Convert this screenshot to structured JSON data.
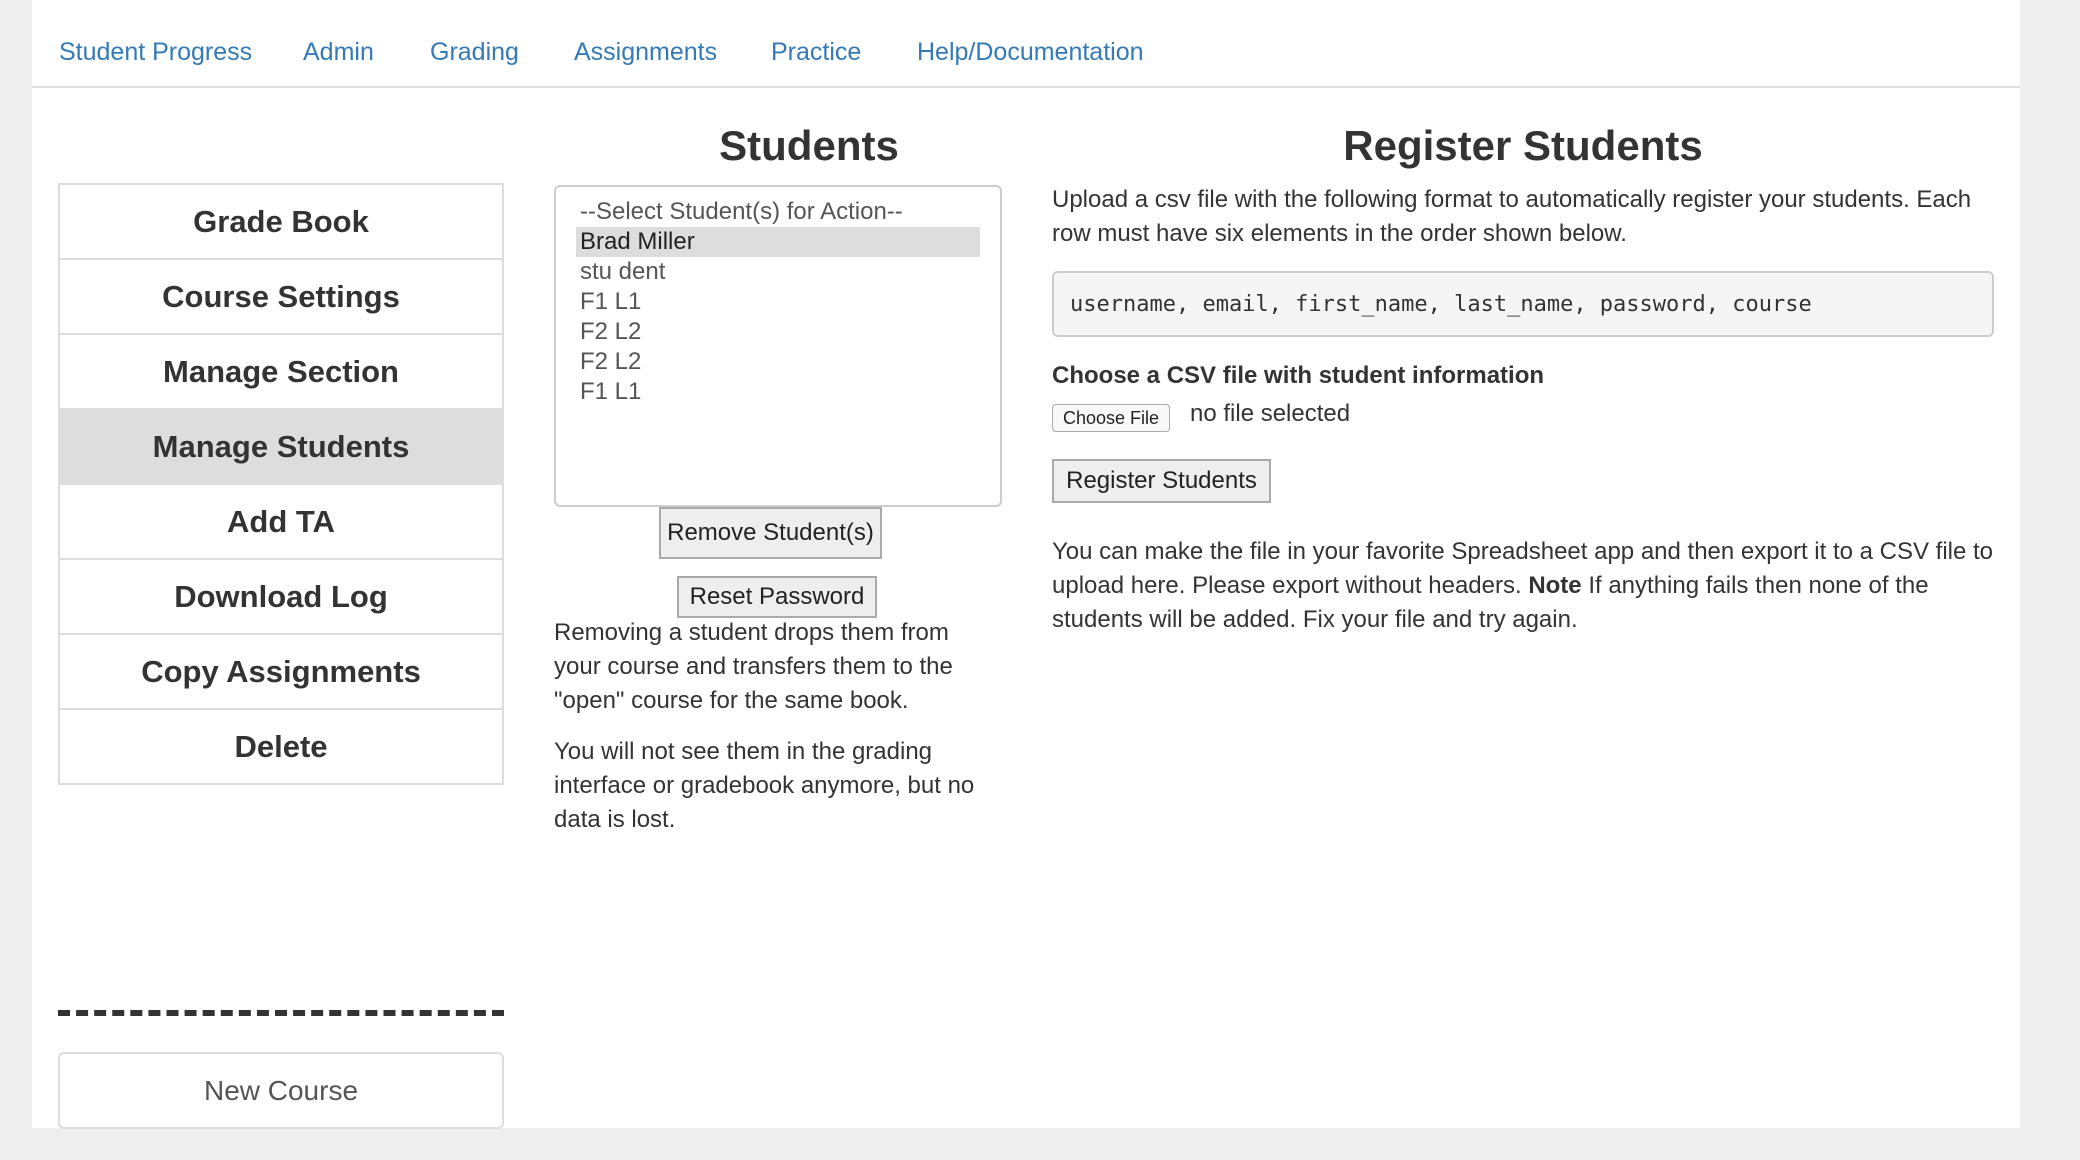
{
  "nav": {
    "items": [
      "Student Progress",
      "Admin",
      "Grading",
      "Assignments",
      "Practice",
      "Help/Documentation"
    ]
  },
  "sidebar": {
    "items": [
      {
        "label": "Grade Book"
      },
      {
        "label": "Course Settings"
      },
      {
        "label": "Manage Section"
      },
      {
        "label": "Manage Students",
        "active": true
      },
      {
        "label": "Add TA"
      },
      {
        "label": "Download Log"
      },
      {
        "label": "Copy Assignments"
      },
      {
        "label": "Delete"
      }
    ],
    "new_course_label": "New Course"
  },
  "students": {
    "title": "Students",
    "options": [
      {
        "label": "--Select Student(s) for Action--"
      },
      {
        "label": "Brad Miller",
        "selected": true
      },
      {
        "label": "stu dent"
      },
      {
        "label": "F1 L1"
      },
      {
        "label": "F2 L2"
      },
      {
        "label": "F2 L2"
      },
      {
        "label": "F1 L1"
      }
    ],
    "remove_label": "Remove Student(s)",
    "reset_label": "Reset Password",
    "note1": "Removing a student drops them from your course and transfers them to the \"open\" course for the same book.",
    "note2": "You will not see them in the grading interface or gradebook anymore, but no data is lost."
  },
  "register": {
    "title": "Register Students",
    "intro": "Upload a csv file with the following format to automatically register your students. Each row must have six elements in the order shown below.",
    "format": "username, email, first_name, last_name, password, course",
    "choose_label": "Choose a CSV file with student information",
    "file_button": "Choose File",
    "file_status": "no file selected",
    "submit_label": "Register Students",
    "help_pre": "You can make the file in your favorite Spreadsheet app and then export it to a CSV file to upload here. Please export without headers.",
    "help_bold": "Note",
    "help_post": "If anything fails then none of the students will be added. Fix your file and try again."
  }
}
